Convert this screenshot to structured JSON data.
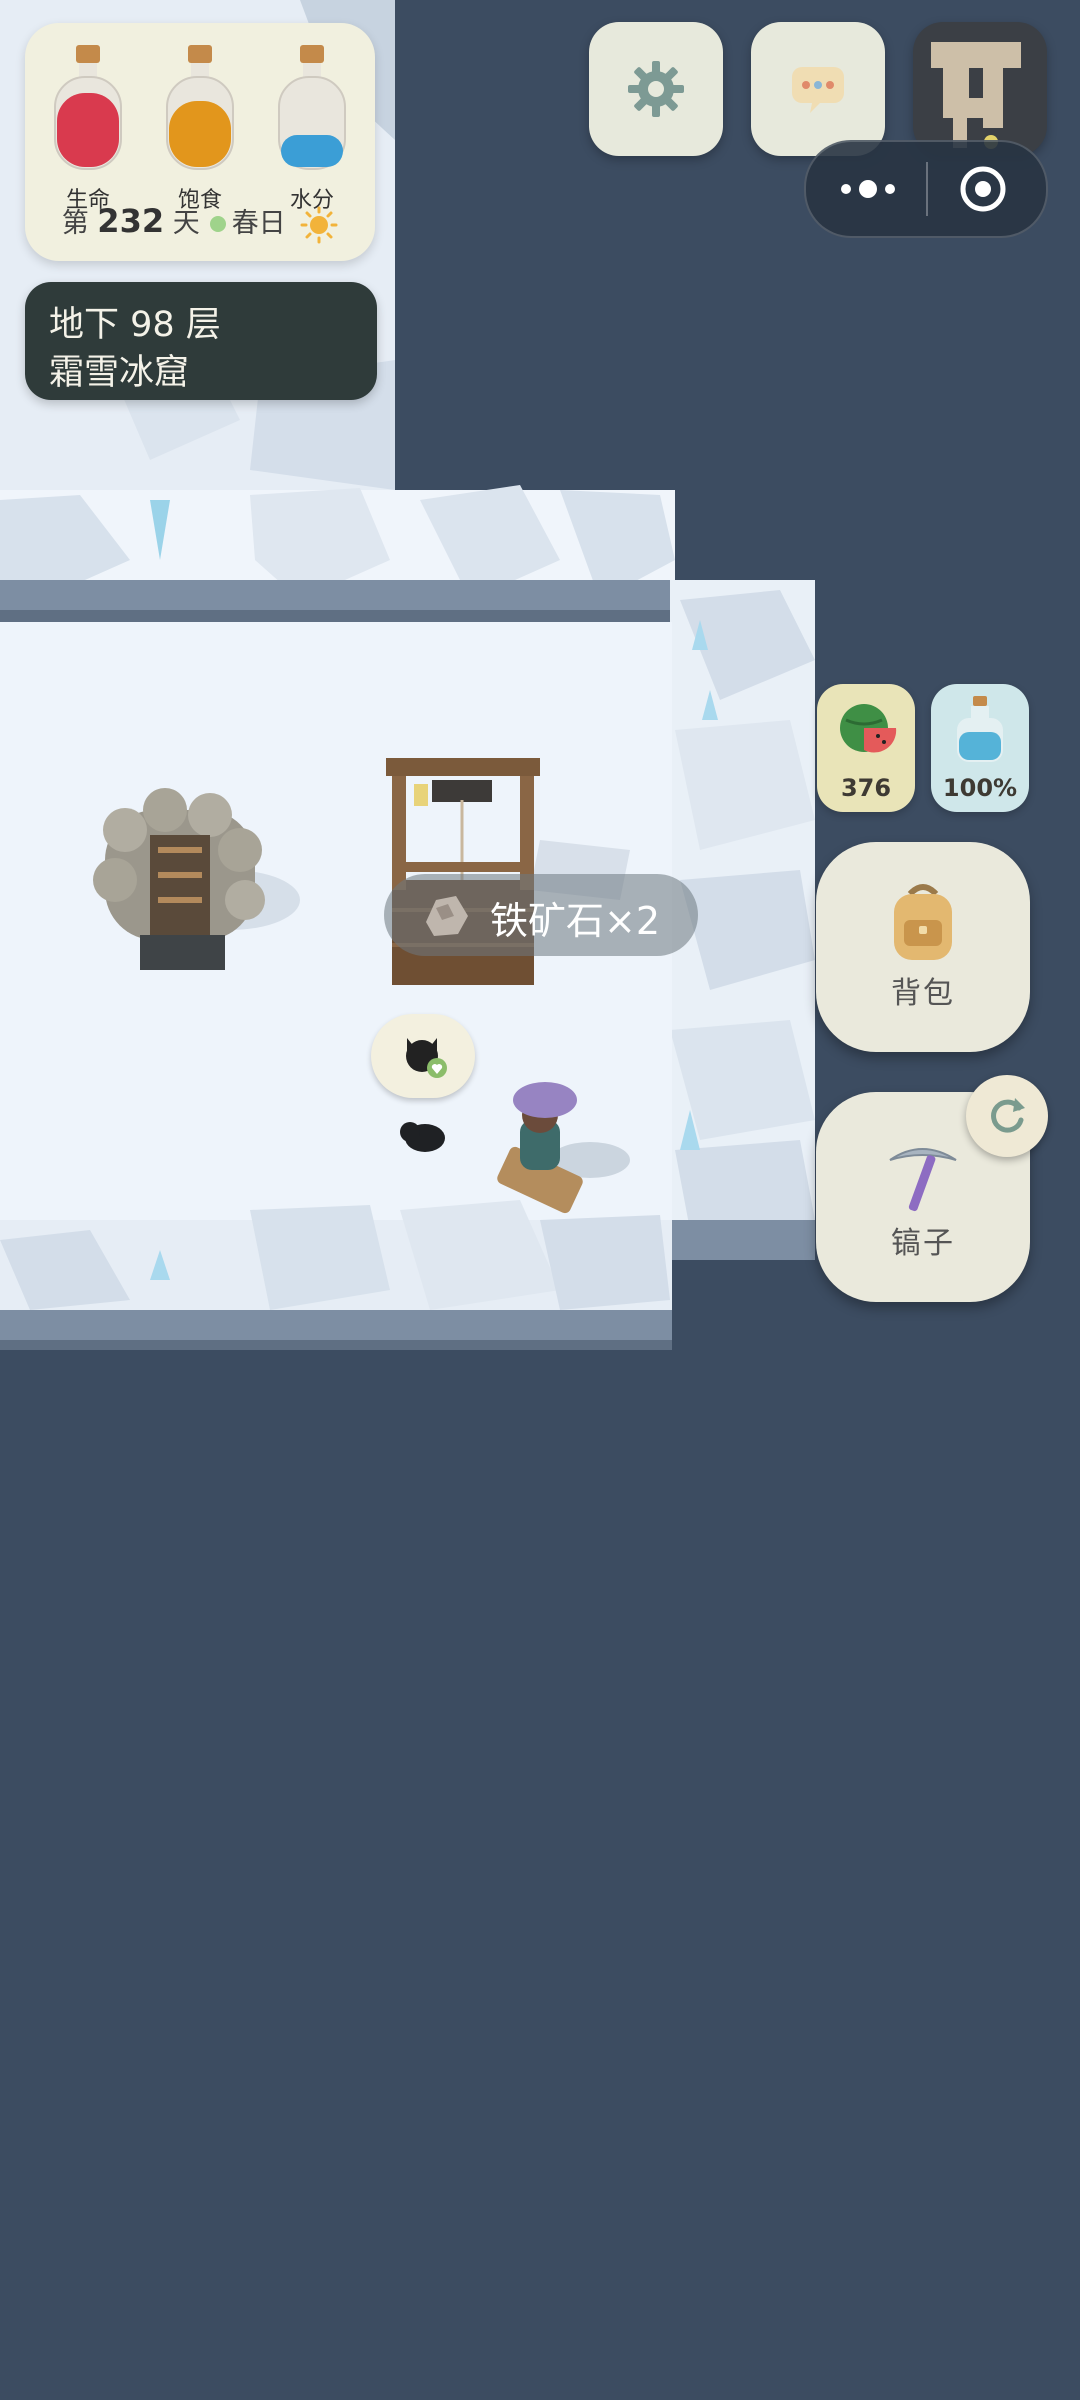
{
  "stats": [
    {
      "label": "生命",
      "fill_percent": 80,
      "color": "#d93a4e"
    },
    {
      "label": "饱食",
      "fill_percent": 70,
      "color": "#e2961c"
    },
    {
      "label": "水分",
      "fill_percent": 35,
      "color": "#3b9ed6"
    }
  ],
  "day": {
    "prefix": "第",
    "number": "232",
    "suffix": "天",
    "season": "春日",
    "weather_icon": "sun-icon"
  },
  "location": {
    "depth": "地下 98 层",
    "name": "霜雪冰窟"
  },
  "top_buttons": [
    {
      "name": "settings-button",
      "icon": "gear-icon"
    },
    {
      "name": "chat-button",
      "icon": "chat-bubble-icon"
    },
    {
      "name": "minimap-button",
      "icon": "map-icon"
    }
  ],
  "capsule": {
    "more_icon": "more-dots-icon",
    "close_icon": "target-circle-icon"
  },
  "resources": {
    "food": {
      "icon": "watermelon-icon",
      "value": "376",
      "color": "#e9e4b8"
    },
    "water": {
      "icon": "water-bottle-icon",
      "value": "100%",
      "color": "#cfe7ea"
    }
  },
  "backpack": {
    "label": "背包",
    "icon": "backpack-icon"
  },
  "tool": {
    "label": "镐子",
    "icon": "pickaxe-icon"
  },
  "refresh": {
    "icon": "refresh-icon"
  },
  "toast": {
    "text": "铁矿石×2",
    "icon": "ore-icon"
  },
  "pet": {
    "icon": "cat-heart-icon"
  },
  "colors": {
    "background": "#3c4c61",
    "ice": "#eef4fb",
    "ice_shadow": "#c9d5e2",
    "panel": "#f1f0df"
  }
}
